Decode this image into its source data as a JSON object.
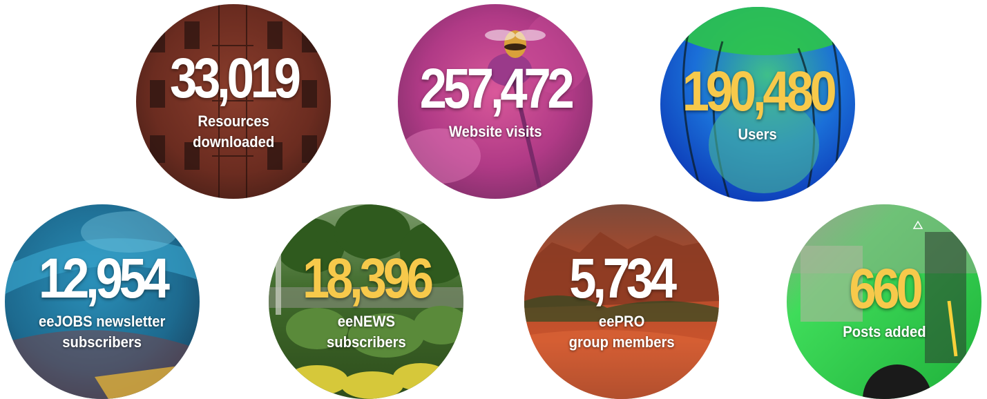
{
  "colors": {
    "white": "#ffffff",
    "yellow": "#f7c94b"
  },
  "stats": [
    {
      "value": "33,019",
      "label": [
        "Resources",
        "downloaded"
      ],
      "value_color": "#ffffff",
      "background": "brick-building-photo"
    },
    {
      "value": "257,472",
      "label": [
        "Website visits"
      ],
      "value_color": "#ffffff",
      "background": "bee-on-pink-flower-photo"
    },
    {
      "value": "190,480",
      "label": [
        "Users"
      ],
      "value_color": "#f7c94b",
      "background": "green-jellyfish-photo"
    },
    {
      "value": "12,954",
      "label": [
        "eeJOBS newsletter",
        "subscribers"
      ],
      "value_color": "#ffffff",
      "background": "beaded-texture-photo"
    },
    {
      "value": "18,396",
      "label": [
        "eeNEWS",
        "subscribers"
      ],
      "value_color": "#f7c94b",
      "background": "plant-nursery-photo"
    },
    {
      "value": "5,734",
      "label": [
        "eePRO",
        "group members"
      ],
      "value_color": "#ffffff",
      "background": "red-canyon-photo"
    },
    {
      "value": "660",
      "label": [
        "Posts added"
      ],
      "value_color": "#f7c94b",
      "background": "green-bus-photo"
    }
  ]
}
